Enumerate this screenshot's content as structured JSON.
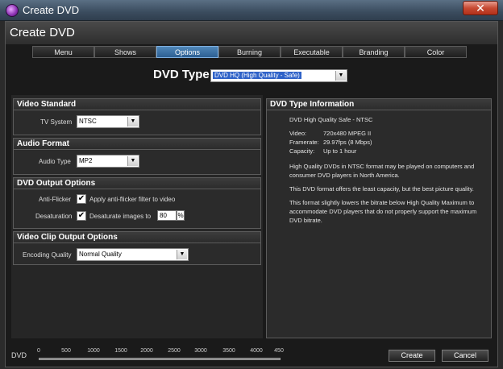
{
  "window": {
    "title": "Create DVD",
    "close_glyph": "✕"
  },
  "page": {
    "title": "Create DVD"
  },
  "tabs": [
    {
      "label": "Menu"
    },
    {
      "label": "Shows"
    },
    {
      "label": "Options",
      "active": true
    },
    {
      "label": "Burning"
    },
    {
      "label": "Executable"
    },
    {
      "label": "Branding"
    },
    {
      "label": "Color"
    }
  ],
  "dvd_type": {
    "label": "DVD Type",
    "value": "DVD HQ (High Quality - Safe)"
  },
  "video_standard": {
    "heading": "Video Standard",
    "tv_system_label": "TV System",
    "tv_system_value": "NTSC"
  },
  "audio_format": {
    "heading": "Audio Format",
    "audio_type_label": "Audio Type",
    "audio_type_value": "MP2"
  },
  "dvd_output": {
    "heading": "DVD Output Options",
    "anti_flicker_label": "Anti-Flicker",
    "anti_flicker_text": "Apply anti-flicker filter to video",
    "anti_flicker_checked": true,
    "desaturation_label": "Desaturation",
    "desaturation_text": "Desaturate images to",
    "desaturation_checked": true,
    "desaturation_value": "80",
    "desaturation_unit": "%"
  },
  "clip_output": {
    "heading": "Video Clip Output Options",
    "encoding_label": "Encoding Quality",
    "encoding_value": "Normal Quality"
  },
  "info": {
    "heading": "DVD Type Information",
    "title_line": "DVD High Quality Safe - NTSC",
    "specs": [
      {
        "k": "Video:",
        "v": "720x480 MPEG II"
      },
      {
        "k": "Framerate:",
        "v": "29.97fps (8 Mbps)"
      },
      {
        "k": "Capacity:",
        "v": "Up to 1 hour"
      }
    ],
    "para1": "High Quality DVDs in NTSC format may be played on computers and consumer DVD players in North America.",
    "para2": "This DVD format offers the least capacity, but the best picture quality.",
    "para3": "This format slightly lowers the bitrate below High Quality Maximum to accommodate DVD players that do not properly support the maximum DVD bitrate."
  },
  "capacity_bar": {
    "label": "DVD",
    "ticks": [
      "0",
      "500",
      "1000",
      "1500",
      "2000",
      "2500",
      "3000",
      "3500",
      "4000",
      "450"
    ]
  },
  "buttons": {
    "create": "Create",
    "cancel": "Cancel"
  }
}
